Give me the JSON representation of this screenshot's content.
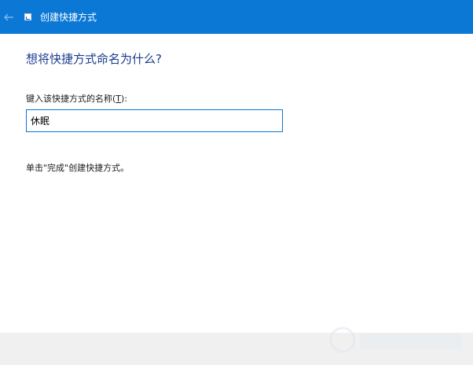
{
  "window": {
    "title": "创建快捷方式",
    "title_icon": "shortcut-icon",
    "back_icon": "back-arrow-icon"
  },
  "main": {
    "question": "想将快捷方式命名为什么?",
    "field_label_prefix": "键入该快捷方式的名称(",
    "field_label_access_key": "T",
    "field_label_suffix": "):",
    "name_value": "休眠",
    "hint": "单击\"完成\"创建快捷方式。"
  },
  "colors": {
    "titlebar": "#0a78d4",
    "question_text": "#1a3a8c",
    "input_border": "#0a78d4",
    "footer": "#f0f0f0"
  }
}
